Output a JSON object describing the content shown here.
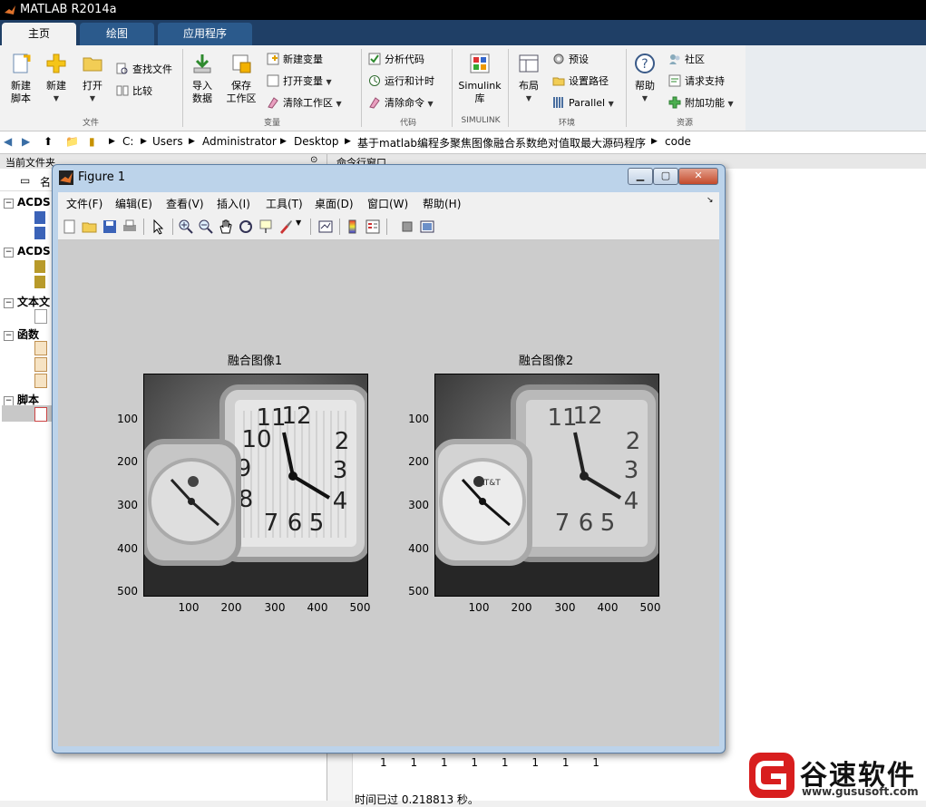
{
  "app": {
    "title": "MATLAB R2014a"
  },
  "tabs": [
    "主页",
    "绘图",
    "应用程序"
  ],
  "ribbon": {
    "file": {
      "label": "文件",
      "new_script": "新建\n脚本",
      "new": "新建",
      "open": "打开",
      "find_files": "查找文件",
      "compare": "比较"
    },
    "variable": {
      "label": "变量",
      "import": "导入\n数据",
      "save": "保存\n工作区",
      "new_var": "新建变量",
      "open_var": "打开变量",
      "clear_ws": "清除工作区"
    },
    "code": {
      "label": "代码",
      "analyze": "分析代码",
      "run_time": "运行和计时",
      "clear_cmd": "清除命令"
    },
    "simulink": {
      "label": "SIMULINK",
      "lib": "Simulink\n库"
    },
    "env": {
      "label": "环境",
      "layout": "布局",
      "prefs": "预设",
      "path": "设置路径",
      "parallel": "Parallel"
    },
    "resources": {
      "label": "资源",
      "help": "帮助",
      "community": "社区",
      "support": "请求支持",
      "addons": "附加功能"
    }
  },
  "address": {
    "crumbs": [
      "C:",
      "Users",
      "Administrator",
      "Desktop",
      "基于matlab编程多聚焦图像融合系数绝对值取最大源码程序",
      "code"
    ]
  },
  "left_panel": {
    "header": "当前文件夹",
    "col": "名",
    "groups": [
      "ACDS",
      "ACDS",
      "文本文",
      "函数",
      "脚本"
    ]
  },
  "cmd_window": {
    "header": "命令行窗口",
    "ones": [
      "1",
      "1",
      "1",
      "1",
      "1",
      "1",
      "1",
      "1"
    ],
    "elapsed": "时间已过 0.218813 秒。"
  },
  "figure": {
    "title": "Figure 1",
    "menu": [
      "文件(F)",
      "编辑(E)",
      "查看(V)",
      "插入(I)",
      "工具(T)",
      "桌面(D)",
      "窗口(W)",
      "帮助(H)"
    ],
    "axes": [
      {
        "title": "融合图像1",
        "yticks": [
          "100",
          "200",
          "300",
          "400",
          "500"
        ],
        "xticks": [
          "100",
          "200",
          "300",
          "400",
          "500"
        ]
      },
      {
        "title": "融合图像2",
        "yticks": [
          "100",
          "200",
          "300",
          "400",
          "500"
        ],
        "xticks": [
          "100",
          "200",
          "300",
          "400",
          "500"
        ]
      }
    ]
  },
  "watermark": {
    "brand": "谷速软件",
    "url": "www.gususoft.com"
  }
}
